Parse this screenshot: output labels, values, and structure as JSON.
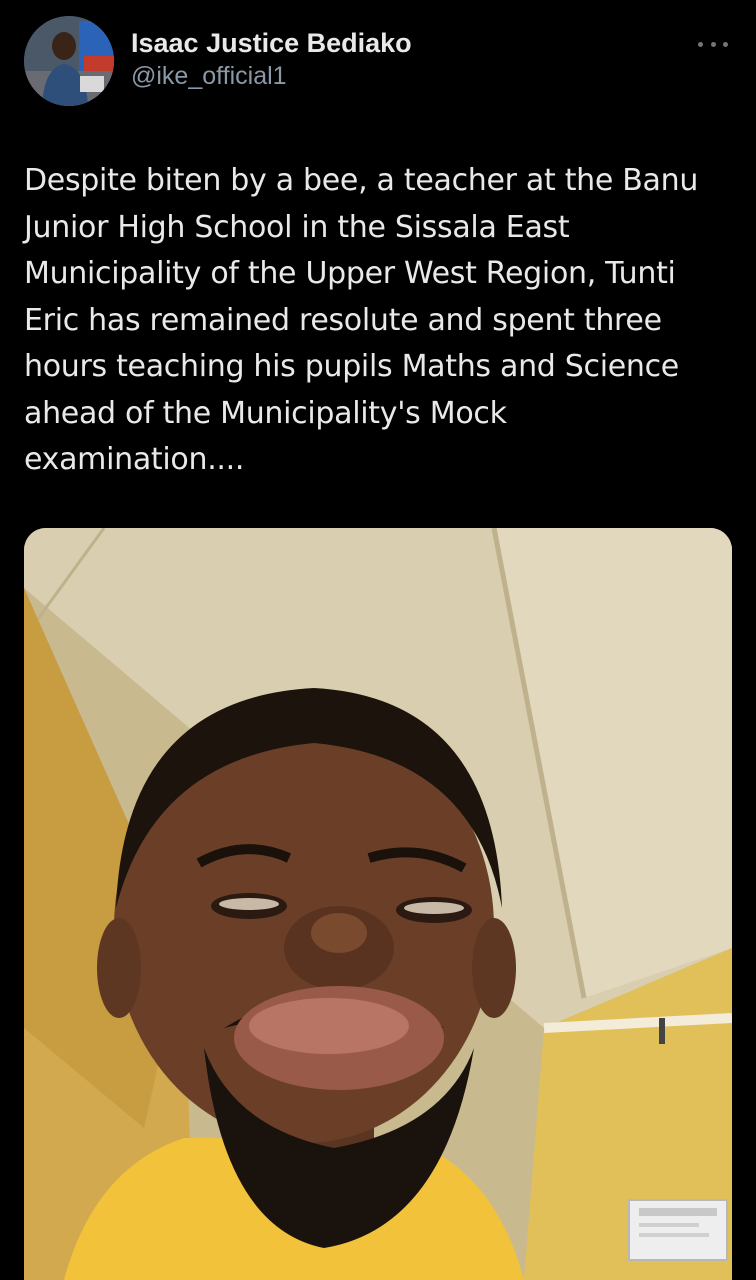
{
  "tweet": {
    "author": {
      "display_name": "Isaac Justice Bediako",
      "handle": "@ike_official1",
      "avatar_icon": "profile-photo"
    },
    "more_icon": "more-horizontal-icon",
    "text": "Despite biten by a bee, a teacher at the Banu Junior High School in the Sissala East Municipality of the Upper West Region, Tunti Eric has remained resolute and spent three hours teaching his pupils Maths and Science ahead of the Municipality's Mock examination....",
    "media": {
      "kind": "photo"
    }
  },
  "colors": {
    "background": "#000000",
    "text_primary": "#e7e9ea",
    "text_secondary": "#8b98a5",
    "shirt_yellow": "#f2c23a",
    "ceiling": "#d8ccaa"
  }
}
